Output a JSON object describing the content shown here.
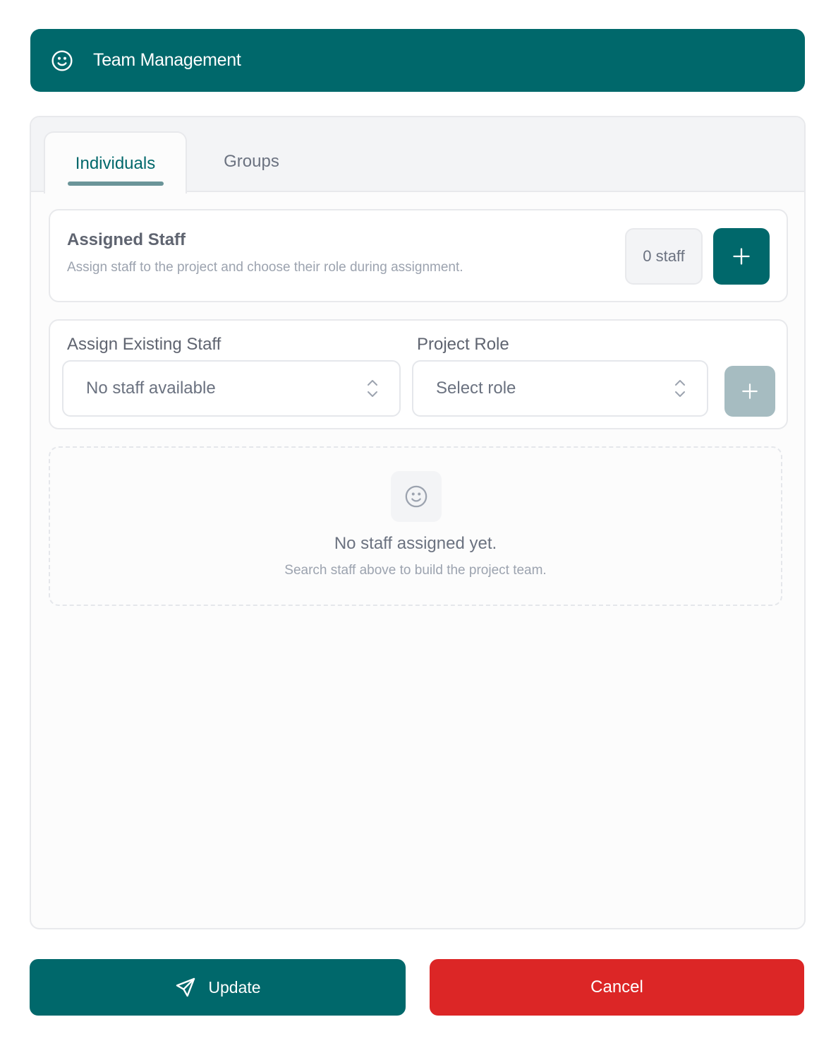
{
  "header": {
    "title": "Team Management",
    "icon": "smile-icon"
  },
  "tabs": [
    {
      "label": "Individuals",
      "active": true
    },
    {
      "label": "Groups",
      "active": false
    }
  ],
  "assigned_staff": {
    "title": "Assigned Staff",
    "subtitle": "Assign staff to the project and choose their role during assignment.",
    "count_badge": "0 staff"
  },
  "assign_form": {
    "staff_label": "Assign Existing Staff",
    "staff_value": "No staff available",
    "role_label": "Project Role",
    "role_value": "Select role"
  },
  "empty_state": {
    "title": "No staff assigned yet.",
    "subtitle": "Search staff above to build the project team."
  },
  "footer": {
    "update_label": "Update",
    "cancel_label": "Cancel"
  },
  "colors": {
    "primary": "#00686b",
    "danger": "#dc2626",
    "disabled": "#a6bcc1"
  }
}
